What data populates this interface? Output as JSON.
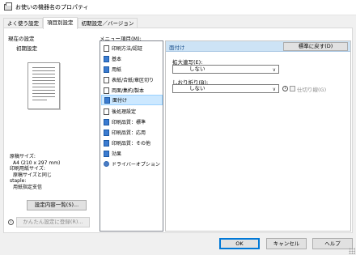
{
  "window": {
    "title": "お使いの機器名のプロパティ",
    "icon": "printer-icon"
  },
  "tabs": [
    {
      "label": "よく使う設定",
      "active": false
    },
    {
      "label": "項目別設定",
      "active": true
    },
    {
      "label": "初期設定／バージョン",
      "active": false
    }
  ],
  "left": {
    "current_label": "現在の設定",
    "preset_label": "初期設定",
    "info_lines": [
      "原稿サイズ:",
      "A4 (210 x 297 mm)",
      "印刷用紙サイズ:",
      "原稿サイズと同じ",
      "staple:",
      "用紙指定支信"
    ],
    "details_button": "設定内容一覧(S)...",
    "register_button": "かんたん設定に登録(R)..."
  },
  "menu": {
    "label": "メニュー項目(M):",
    "items": [
      {
        "label": "印刷方法/認証",
        "icon": "print-method-icon",
        "selected": false
      },
      {
        "label": "基本",
        "icon": "basic-icon",
        "selected": false
      },
      {
        "label": "用紙",
        "icon": "paper-icon",
        "selected": false
      },
      {
        "label": "表紙/合紙/章区切り",
        "icon": "cover-icon",
        "selected": false
      },
      {
        "label": "両面/集約/製本",
        "icon": "duplex-icon",
        "selected": false
      },
      {
        "label": "面付け",
        "icon": "imposition-icon",
        "selected": true
      },
      {
        "label": "後処理設定",
        "icon": "finishing-icon",
        "selected": false
      },
      {
        "label": "印刷品質：標準",
        "icon": "quality-standard-icon",
        "selected": false
      },
      {
        "label": "印刷品質：応用",
        "icon": "quality-advanced-icon",
        "selected": false
      },
      {
        "label": "印刷品質：その他",
        "icon": "quality-other-icon",
        "selected": false
      },
      {
        "label": "効果",
        "icon": "effects-icon",
        "selected": false
      },
      {
        "label": "ドライバーオプション",
        "icon": "gear-icon",
        "selected": false
      }
    ]
  },
  "panel": {
    "title": "面付け",
    "default_button": "標準に戻す(D)",
    "enlarge_label": "拡大連写(E):",
    "enlarge_value": "しない",
    "fold_label": "しおり折り(B):",
    "fold_value": "しない",
    "fold_line_label": "仕切り線(G)"
  },
  "footer": {
    "ok": "OK",
    "cancel": "キャンセル",
    "help": "ヘルプ"
  }
}
